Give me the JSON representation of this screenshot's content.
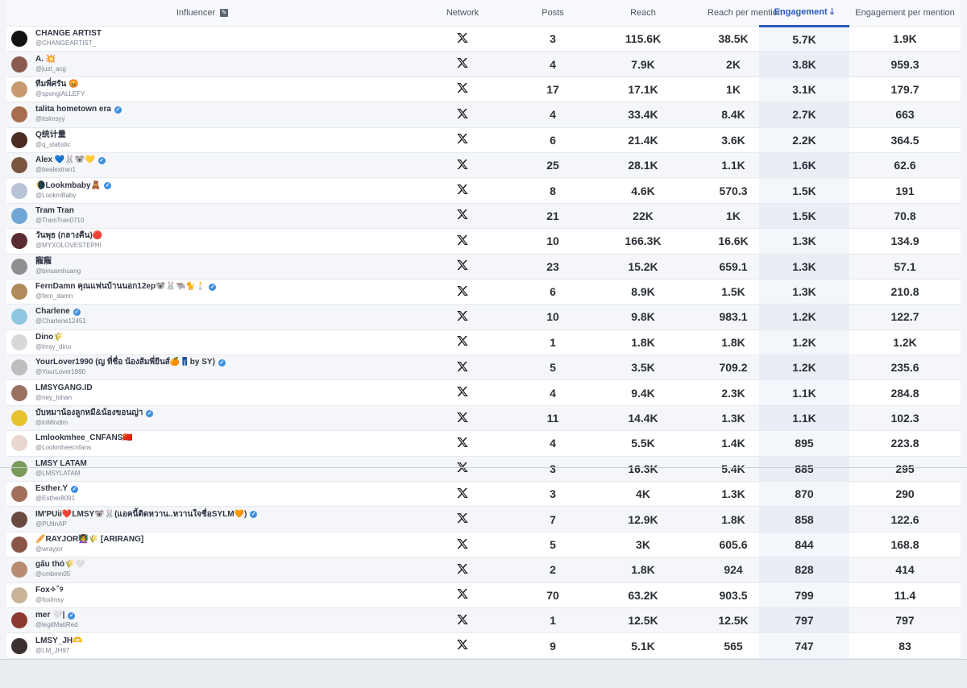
{
  "header": {
    "influencer": "Influencer",
    "network": "Network",
    "posts": "Posts",
    "reach": "Reach",
    "reach_per_mention": "Reach per mention",
    "engagement": "Engagement",
    "engagement_per_mention": "Engagement per mention"
  },
  "colors": {
    "accent": "#2b59c3",
    "verified": "#3d8fe0"
  },
  "rows": [
    {
      "name": "CHANGE ARTIST",
      "handle": "@CHANGEARTIST_",
      "verified": false,
      "avatar": "#111111",
      "network": "x-icon",
      "posts": "3",
      "reach": "115.6K",
      "rpm": "38.5K",
      "eng": "5.7K",
      "epm": "1.9K"
    },
    {
      "name": "A. 💥",
      "handle": "@just_acg",
      "verified": false,
      "avatar": "#8a5a50",
      "network": "x-icon",
      "posts": "4",
      "reach": "7.9K",
      "rpm": "2K",
      "eng": "3.8K",
      "epm": "959.3"
    },
    {
      "name": "ทีมพี่ศรัน 😡",
      "handle": "@spongiALLEFY",
      "verified": false,
      "avatar": "#c79a70",
      "network": "x-icon",
      "posts": "17",
      "reach": "17.1K",
      "rpm": "1K",
      "eng": "3.1K",
      "epm": "179.7"
    },
    {
      "name": "talita hometown era",
      "handle": "@itslmsyy",
      "verified": true,
      "avatar": "#a86d4f",
      "network": "x-icon",
      "posts": "4",
      "reach": "33.4K",
      "rpm": "8.4K",
      "eng": "2.7K",
      "epm": "663"
    },
    {
      "name": "Q统计量",
      "handle": "@q_statistic",
      "verified": false,
      "avatar": "#4b2a24",
      "network": "x-icon",
      "posts": "6",
      "reach": "21.4K",
      "rpm": "3.6K",
      "eng": "2.2K",
      "epm": "364.5"
    },
    {
      "name": "Alex 💙🐰🐨💛",
      "handle": "@bealextran1",
      "verified": true,
      "avatar": "#7a5540",
      "network": "x-icon",
      "posts": "25",
      "reach": "28.1K",
      "rpm": "1.1K",
      "eng": "1.6K",
      "epm": "62.6"
    },
    {
      "name": "🌘Lookmbaby🧸",
      "handle": "@LookmBaby",
      "verified": true,
      "avatar": "#b7c2d6",
      "network": "x-icon",
      "posts": "8",
      "reach": "4.6K",
      "rpm": "570.3",
      "eng": "1.5K",
      "epm": "191"
    },
    {
      "name": "Tram Tran",
      "handle": "@TramTran0710",
      "verified": false,
      "avatar": "#6fa6d6",
      "network": "x-icon",
      "posts": "21",
      "reach": "22K",
      "rpm": "1K",
      "eng": "1.5K",
      "epm": "70.8"
    },
    {
      "name": "วันพุธ (กลางคืน)🔴",
      "handle": "@MYXOLOVESTEPHI",
      "verified": false,
      "avatar": "#5a2b30",
      "network": "x-icon",
      "posts": "10",
      "reach": "166.3K",
      "rpm": "16.6K",
      "eng": "1.3K",
      "epm": "134.9"
    },
    {
      "name": "寵寵",
      "handle": "@binsamhuang",
      "verified": false,
      "avatar": "#8f8f8f",
      "network": "x-icon",
      "posts": "23",
      "reach": "15.2K",
      "rpm": "659.1",
      "eng": "1.3K",
      "epm": "57.1"
    },
    {
      "name": "FernDamn คุณแฟนบ้านนอก12ep🐨🐰🐃🐈🕯️",
      "handle": "@fern_damn",
      "verified": true,
      "avatar": "#b08a5a",
      "network": "x-icon",
      "posts": "6",
      "reach": "8.9K",
      "rpm": "1.5K",
      "eng": "1.3K",
      "epm": "210.8"
    },
    {
      "name": "Charlene",
      "handle": "@Charlene12451",
      "verified": true,
      "avatar": "#8fc7e0",
      "network": "x-icon",
      "posts": "10",
      "reach": "9.8K",
      "rpm": "983.1",
      "eng": "1.2K",
      "epm": "122.7"
    },
    {
      "name": "Dino🌾",
      "handle": "@lmsy_dino",
      "verified": false,
      "avatar": "#d8d8d8",
      "network": "x-icon",
      "posts": "1",
      "reach": "1.8K",
      "rpm": "1.8K",
      "eng": "1.2K",
      "epm": "1.2K"
    },
    {
      "name": "YourLover1990 (ญ ที่ชื่อ น้องส้มพี่ยีนส์🍊👖by SY)",
      "handle": "@YourLover1990",
      "verified": true,
      "avatar": "#bdbdbd",
      "network": "x-icon",
      "posts": "5",
      "reach": "3.5K",
      "rpm": "709.2",
      "eng": "1.2K",
      "epm": "235.6"
    },
    {
      "name": "LMSYGANG.ID",
      "handle": "@ney_lohan",
      "verified": false,
      "avatar": "#9a7060",
      "network": "x-icon",
      "posts": "4",
      "reach": "9.4K",
      "rpm": "2.3K",
      "eng": "1.1K",
      "epm": "284.8"
    },
    {
      "name": "บับหมาน้องลูกหมี&น้องขอนญ่า",
      "handle": "@inMindlm",
      "verified": true,
      "avatar": "#e6c22f",
      "network": "x-icon",
      "posts": "11",
      "reach": "14.4K",
      "rpm": "1.3K",
      "eng": "1.1K",
      "epm": "102.3"
    },
    {
      "name": "Lmlookmhee_CNFANS🇨🇳",
      "handle": "@Lookmheecnfans",
      "verified": false,
      "avatar": "#e8d6cf",
      "network": "x-icon",
      "posts": "4",
      "reach": "5.5K",
      "rpm": "1.4K",
      "eng": "895",
      "epm": "223.8"
    },
    {
      "name": "LMSY LATAM",
      "handle": "@LMSYLATAM",
      "verified": false,
      "avatar": "#7a9a5a",
      "network": "x-icon",
      "posts": "3",
      "reach": "16.3K",
      "rpm": "5.4K",
      "eng": "885",
      "epm": "295"
    },
    {
      "name": "Esther.Y",
      "handle": "@Esther8091",
      "verified": true,
      "avatar": "#a0705a",
      "network": "x-icon",
      "posts": "3",
      "reach": "4K",
      "rpm": "1.3K",
      "eng": "870",
      "epm": "290"
    },
    {
      "name": "IM'PUii❤️LMSY🐨🐰(แอคนี้ติดหวาน..หวานใจชื่อSYLM🧡)",
      "handle": "@PUIInAP",
      "verified": true,
      "avatar": "#6a4a40",
      "network": "x-icon",
      "posts": "7",
      "reach": "12.9K",
      "rpm": "1.8K",
      "eng": "858",
      "epm": "122.6"
    },
    {
      "name": "🥖RAYJOR👩‍🏫🌾 [ARIRANG]",
      "handle": "@wrayjor",
      "verified": false,
      "avatar": "#8a5548",
      "network": "x-icon",
      "posts": "5",
      "reach": "3K",
      "rpm": "605.6",
      "eng": "844",
      "epm": "168.8"
    },
    {
      "name": "gấu thỏ🌾🤍",
      "handle": "@cmbmn05",
      "verified": false,
      "avatar": "#b88c70",
      "network": "x-icon",
      "posts": "2",
      "reach": "1.8K",
      "rpm": "924",
      "eng": "828",
      "epm": "414"
    },
    {
      "name": "Fox✧˚୨",
      "handle": "@foxlmsy",
      "verified": false,
      "avatar": "#c9b49a",
      "network": "x-icon",
      "posts": "70",
      "reach": "63.2K",
      "rpm": "903.5",
      "eng": "799",
      "epm": "11.4"
    },
    {
      "name": "mer 🤍|",
      "handle": "@legitMatiRed",
      "verified": true,
      "avatar": "#8c3a30",
      "network": "x-icon",
      "posts": "1",
      "reach": "12.5K",
      "rpm": "12.5K",
      "eng": "797",
      "epm": "797"
    },
    {
      "name": "LMSY_JH🫶",
      "handle": "@LM_JH97",
      "verified": false,
      "avatar": "#3a3030",
      "network": "x-icon",
      "posts": "9",
      "reach": "5.1K",
      "rpm": "565",
      "eng": "747",
      "epm": "83"
    }
  ]
}
